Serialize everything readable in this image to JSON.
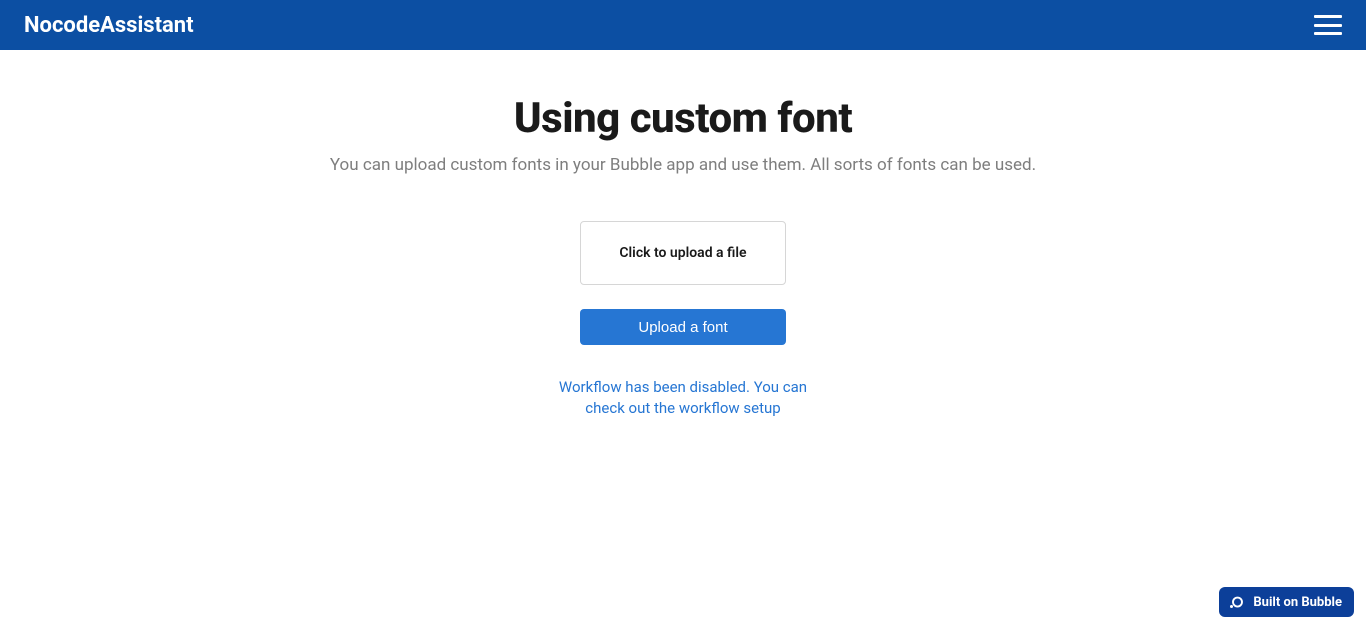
{
  "header": {
    "brand": "NocodeAssistant"
  },
  "main": {
    "title": "Using custom font",
    "subtitle": "You can upload custom fonts in your Bubble app and use them. All sorts of fonts can be used.",
    "uploadBoxLabel": "Click to upload a file",
    "uploadButtonLabel": "Upload a font",
    "workflowNotice": "Workflow has been disabled. You can check out the workflow setup"
  },
  "badge": {
    "label": "Built on Bubble"
  },
  "colors": {
    "headerBg": "#0c4fa3",
    "accent": "#2676d3",
    "badgeBg": "#0c3f99"
  }
}
